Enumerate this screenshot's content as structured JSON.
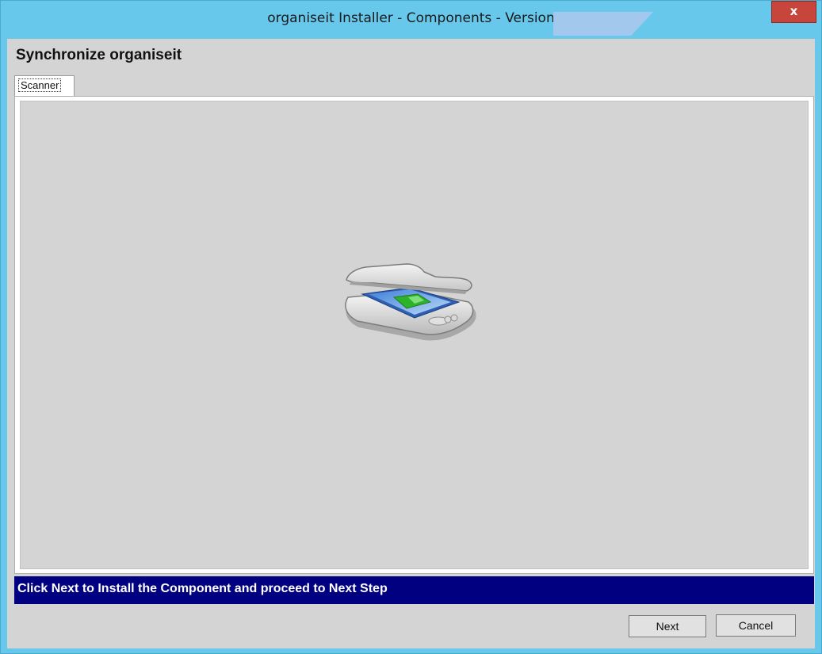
{
  "window": {
    "title": "organiseit Installer - Components - Version ",
    "close_glyph": "x"
  },
  "page": {
    "heading": "Synchronize organiseit",
    "tabs": [
      {
        "label": "Scanner",
        "selected": true
      }
    ]
  },
  "content": {
    "icon": "scanner-icon"
  },
  "status": {
    "message": "Click Next to Install the Component and proceed to Next Step"
  },
  "buttons": {
    "next_label": "Next",
    "cancel_label": "Cancel"
  },
  "colors": {
    "titlebar": "#67c8ec",
    "close_button": "#c7453b",
    "status_bar": "#000080",
    "client_bg": "#d4d4d4"
  }
}
